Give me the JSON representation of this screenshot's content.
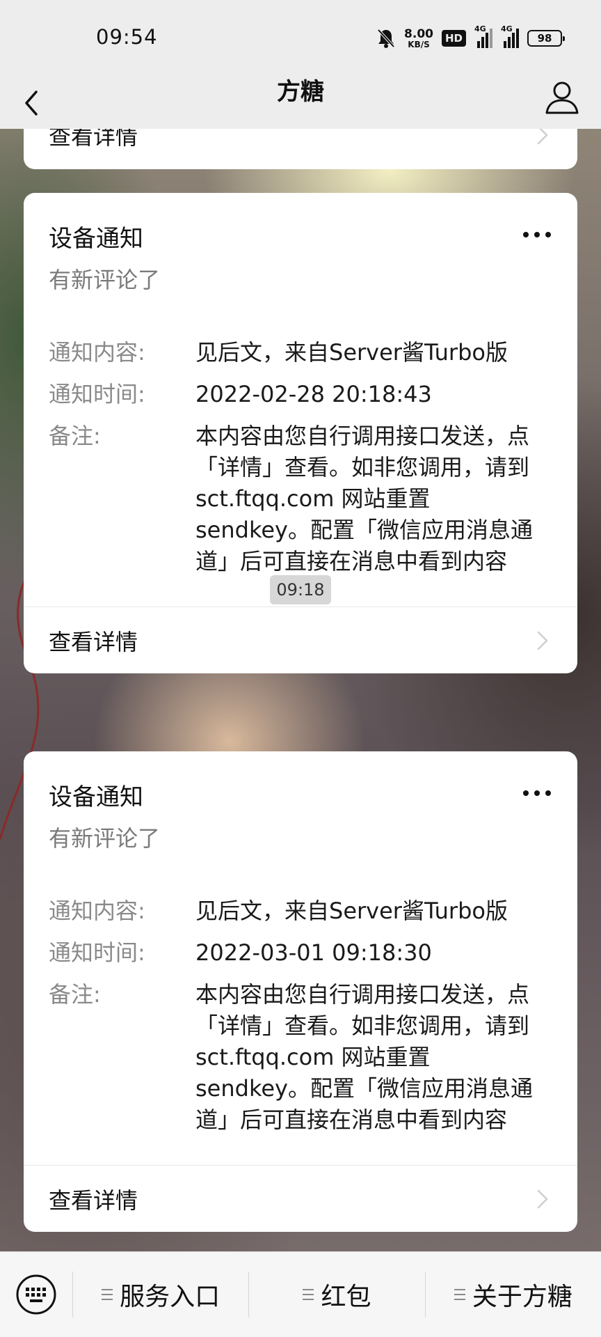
{
  "status_bar": {
    "time": "09:54",
    "net_speed_value": "8.00",
    "net_speed_unit": "KB/S",
    "hd_label": "HD",
    "signal_1": "4G",
    "signal_2": "4G",
    "battery": "98",
    "icons": [
      "mute-bell-icon",
      "hd-icon",
      "signal-icon",
      "signal-icon",
      "battery-icon"
    ]
  },
  "nav": {
    "title": "方糖",
    "back_icon": "chevron-left-icon",
    "profile_icon": "person-icon"
  },
  "messages": {
    "partial_card": {
      "detail_label": "查看详情"
    },
    "timestamp": "09:18",
    "cards": [
      {
        "title": "设备通知",
        "subtitle": "有新评论了",
        "fields": [
          {
            "key": "通知内容:",
            "value": "见后文，来自Server酱Turbo版"
          },
          {
            "key": "通知时间:",
            "value": "2022-02-28 20:18:43"
          },
          {
            "key": "备注:",
            "value": "本内容由您自行调用接口发送，点「详情」查看。如非您调用，请到 sct.ftqq.com 网站重置 sendkey。配置「微信应用消息通道」后可直接在消息中看到内容"
          }
        ],
        "detail_label": "查看详情"
      },
      {
        "title": "设备通知",
        "subtitle": "有新评论了",
        "fields": [
          {
            "key": "通知内容:",
            "value": "见后文，来自Server酱Turbo版"
          },
          {
            "key": "通知时间:",
            "value": "2022-03-01 09:18:30"
          },
          {
            "key": "备注:",
            "value": "本内容由您自行调用接口发送，点「详情」查看。如非您调用，请到 sct.ftqq.com 网站重置 sendkey。配置「微信应用消息通道」后可直接在消息中看到内容"
          }
        ],
        "detail_label": "查看详情"
      }
    ]
  },
  "bottom_menu": {
    "keyboard_icon": "keyboard-icon",
    "items": [
      {
        "label": "服务入口"
      },
      {
        "label": "红包"
      },
      {
        "label": "关于方糖"
      }
    ]
  }
}
